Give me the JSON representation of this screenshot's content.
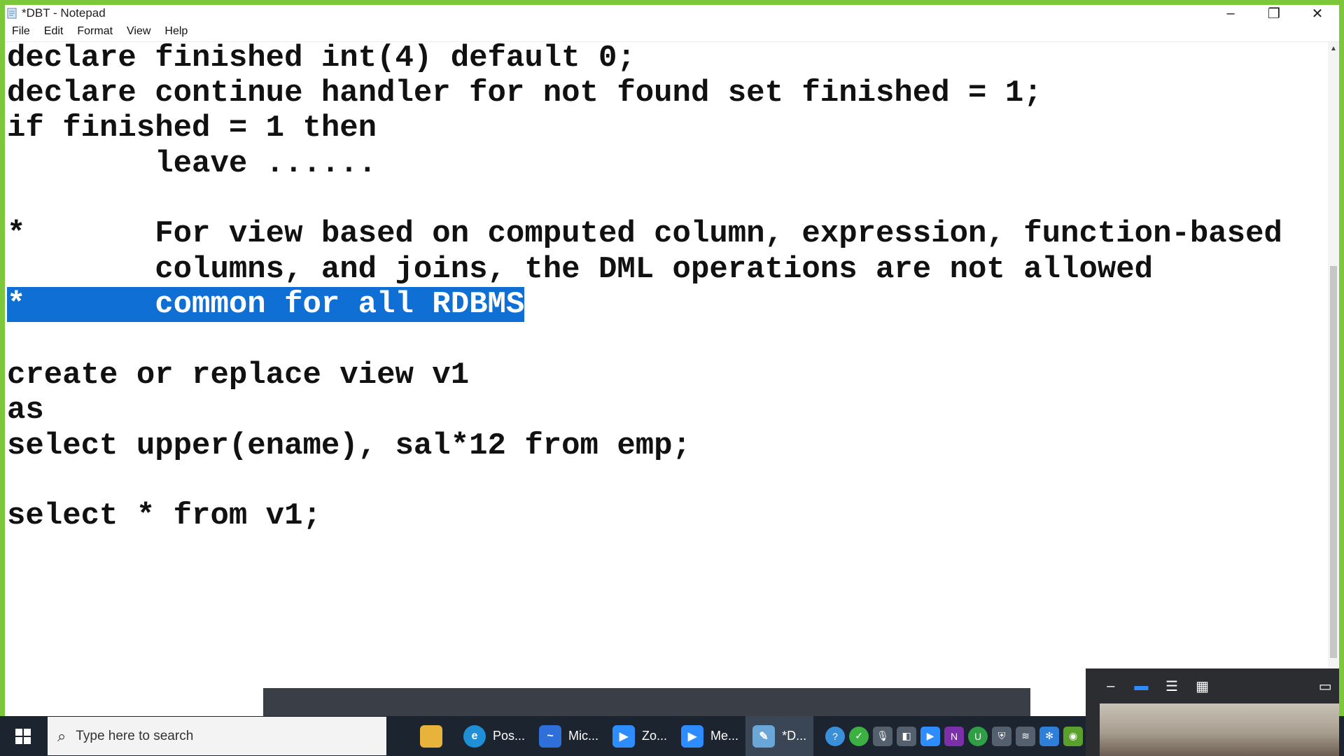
{
  "window": {
    "title": "*DBT - Notepad",
    "controls": [
      "minimize",
      "restore",
      "close"
    ]
  },
  "menu": [
    "File",
    "Edit",
    "Format",
    "View",
    "Help"
  ],
  "editor": {
    "lines": [
      "declare finished int(4) default 0;",
      "declare continue handler for not found set finished = 1;",
      "if finished = 1 then",
      "        leave ......",
      "",
      "*       For view based on computed column, expression, function-based",
      "        columns, and joins, the DML operations are not allowed",
      "*       common for all RDBMS",
      "",
      "create or replace view v1",
      "as",
      "select upper(ename), sal*12 from emp;",
      "",
      "select * from v1;"
    ],
    "selected_line_index": 7
  },
  "taskbar": {
    "search_placeholder": "Type here to search",
    "apps": [
      {
        "label": "Pos...",
        "icon": "edge-icon",
        "color": "#1f8fd6"
      },
      {
        "label": "Mic...",
        "icon": "whiteboard-icon",
        "color": "#2f6fd9"
      },
      {
        "label": "Zo...",
        "icon": "zoom-icon",
        "color": "#2d8cff"
      },
      {
        "label": "Me...",
        "icon": "zoom-meeting-icon",
        "color": "#2d8cff"
      },
      {
        "label": "*D...",
        "icon": "notepad-icon",
        "color": "#6aa7d8",
        "active": true
      }
    ],
    "tray_icons": [
      "help-icon",
      "check-icon",
      "mic-icon",
      "tag-icon",
      "zoom-icon",
      "onenote-icon",
      "upwork-icon",
      "shield-icon",
      "wifi-icon",
      "snowflake-icon",
      "nvidia-icon",
      "device-icon"
    ]
  },
  "video_panel": {
    "controls": [
      "minimize-icon",
      "speaker-view-icon",
      "strip-view-icon",
      "gallery-view-icon",
      "fullscreen-icon"
    ]
  },
  "colors": {
    "frame": "#7cc83a",
    "selection": "#0f6fd4",
    "taskbar": "#1c2430"
  }
}
